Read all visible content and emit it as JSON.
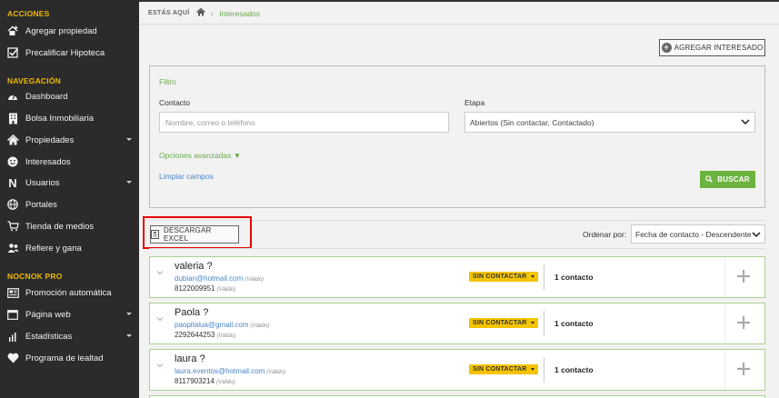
{
  "sidebar": {
    "sections": [
      {
        "title": "ACCIONES",
        "items": [
          {
            "label": "Agregar propiedad",
            "icon": "add-home-icon"
          },
          {
            "label": "Precalificar Hipoteca",
            "icon": "checkbox-icon"
          }
        ]
      },
      {
        "title": "NAVEGACIÓN",
        "items": [
          {
            "label": "Dashboard",
            "icon": "dashboard-icon"
          },
          {
            "label": "Bolsa Inmobiliaria",
            "icon": "building-icon"
          },
          {
            "label": "Propiedades",
            "icon": "home-icon"
          },
          {
            "label": "Interesados",
            "icon": "smiley-icon"
          },
          {
            "label": "Usuarios",
            "icon": "n-logo-icon"
          },
          {
            "label": "Portales",
            "icon": "globe-icon"
          },
          {
            "label": "Tienda de medios",
            "icon": "cart-icon"
          },
          {
            "label": "Refiere y gana",
            "icon": "users-icon"
          }
        ]
      },
      {
        "title": "NOCNOK PRO",
        "items": [
          {
            "label": "Promoción automática",
            "icon": "newspaper-icon"
          },
          {
            "label": "Página web",
            "icon": "browser-icon"
          },
          {
            "label": "Estadísticas",
            "icon": "bar-chart-icon"
          },
          {
            "label": "Programa de lealtad",
            "icon": "heart-icon"
          }
        ]
      }
    ]
  },
  "breadcrumb": {
    "here": "ESTÁS AQUÍ",
    "separator": "›",
    "current": "Interesados"
  },
  "header": {
    "add_button": "AGREGAR INTERESADO"
  },
  "filter": {
    "title": "Filtro",
    "contact_label": "Contacto",
    "contact_placeholder": "Nombre, correo o teléfono",
    "contact_value": "",
    "stage_label": "Etapa",
    "stage_value": "Abiertos (Sin contactar, Contactado)",
    "advanced": "Opciones avanzadas ▼",
    "clear": "Limpiar campos",
    "search": "BUSCAR"
  },
  "toolbar": {
    "download": "DESCARGAR EXCEL",
    "order_label": "Ordenar por:",
    "order_value": "Fecha de contacto - Descendente"
  },
  "leads": [
    {
      "name": "valeria ?",
      "email": "dubian@hotmail.com",
      "email_status": "(Válido)",
      "phone": "8122009951",
      "phone_status": "(Válido)",
      "status": "SIN CONTACTAR",
      "contacts": "1 contacto"
    },
    {
      "name": "Paola ?",
      "email": "paopitalua@gmail.com",
      "email_status": "(Válido)",
      "phone": "2292644253",
      "phone_status": "(Válido)",
      "status": "SIN CONTACTAR",
      "contacts": "1 contacto"
    },
    {
      "name": "laura ?",
      "email": "laura.eventos@hotmail.com",
      "email_status": "(Válido)",
      "phone": "8117903214",
      "phone_status": "(Válido)",
      "status": "SIN CONTACTAR",
      "contacts": "1 contacto"
    }
  ],
  "colors": {
    "sidebar_bg": "#2b2b2b",
    "section_title": "#f0b800",
    "accent_green": "#6db33f",
    "badge_yellow": "#f4c400",
    "highlight_red": "#e60000",
    "link_blue": "#4a86c8"
  }
}
